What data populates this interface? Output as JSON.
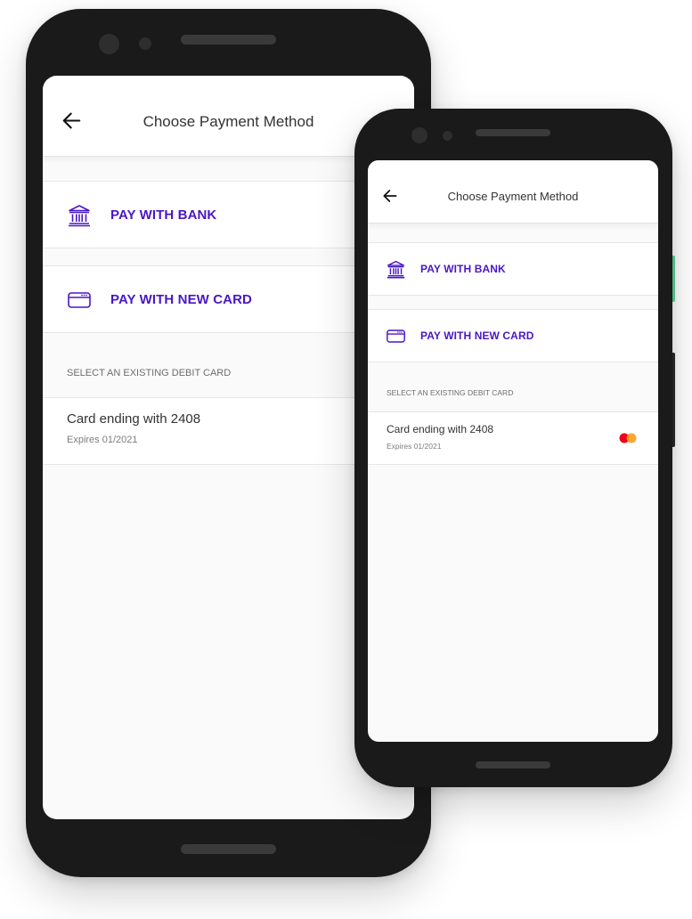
{
  "colors": {
    "brand_purple": "#4a17c4",
    "phone_body": "#1a1a1a",
    "mastercard_red": "#eb001b",
    "mastercard_orange": "#f79e1b",
    "side_button_accent": "#5fd39a"
  },
  "large_phone": {
    "header": {
      "title": "Choose Payment Method",
      "back_icon": "back-arrow-icon"
    },
    "options": [
      {
        "label": "PAY WITH BANK",
        "icon": "bank-icon"
      },
      {
        "label": "PAY WITH NEW CARD",
        "icon": "credit-card-icon"
      }
    ],
    "existing_section": {
      "label": "SELECT AN EXISTING DEBIT CARD",
      "cards": [
        {
          "title": "Card ending with 2408",
          "expiry": "Expires 01/2021"
        }
      ]
    }
  },
  "small_phone": {
    "header": {
      "title": "Choose Payment Method",
      "back_icon": "back-arrow-icon"
    },
    "options": [
      {
        "label": "PAY WITH BANK",
        "icon": "bank-icon"
      },
      {
        "label": "PAY WITH NEW CARD",
        "icon": "credit-card-icon"
      }
    ],
    "existing_section": {
      "label": "SELECT AN EXISTING DEBIT CARD",
      "cards": [
        {
          "title": "Card ending with 2408",
          "expiry": "Expires 01/2021",
          "brand_icon": "mastercard-icon"
        }
      ]
    }
  }
}
